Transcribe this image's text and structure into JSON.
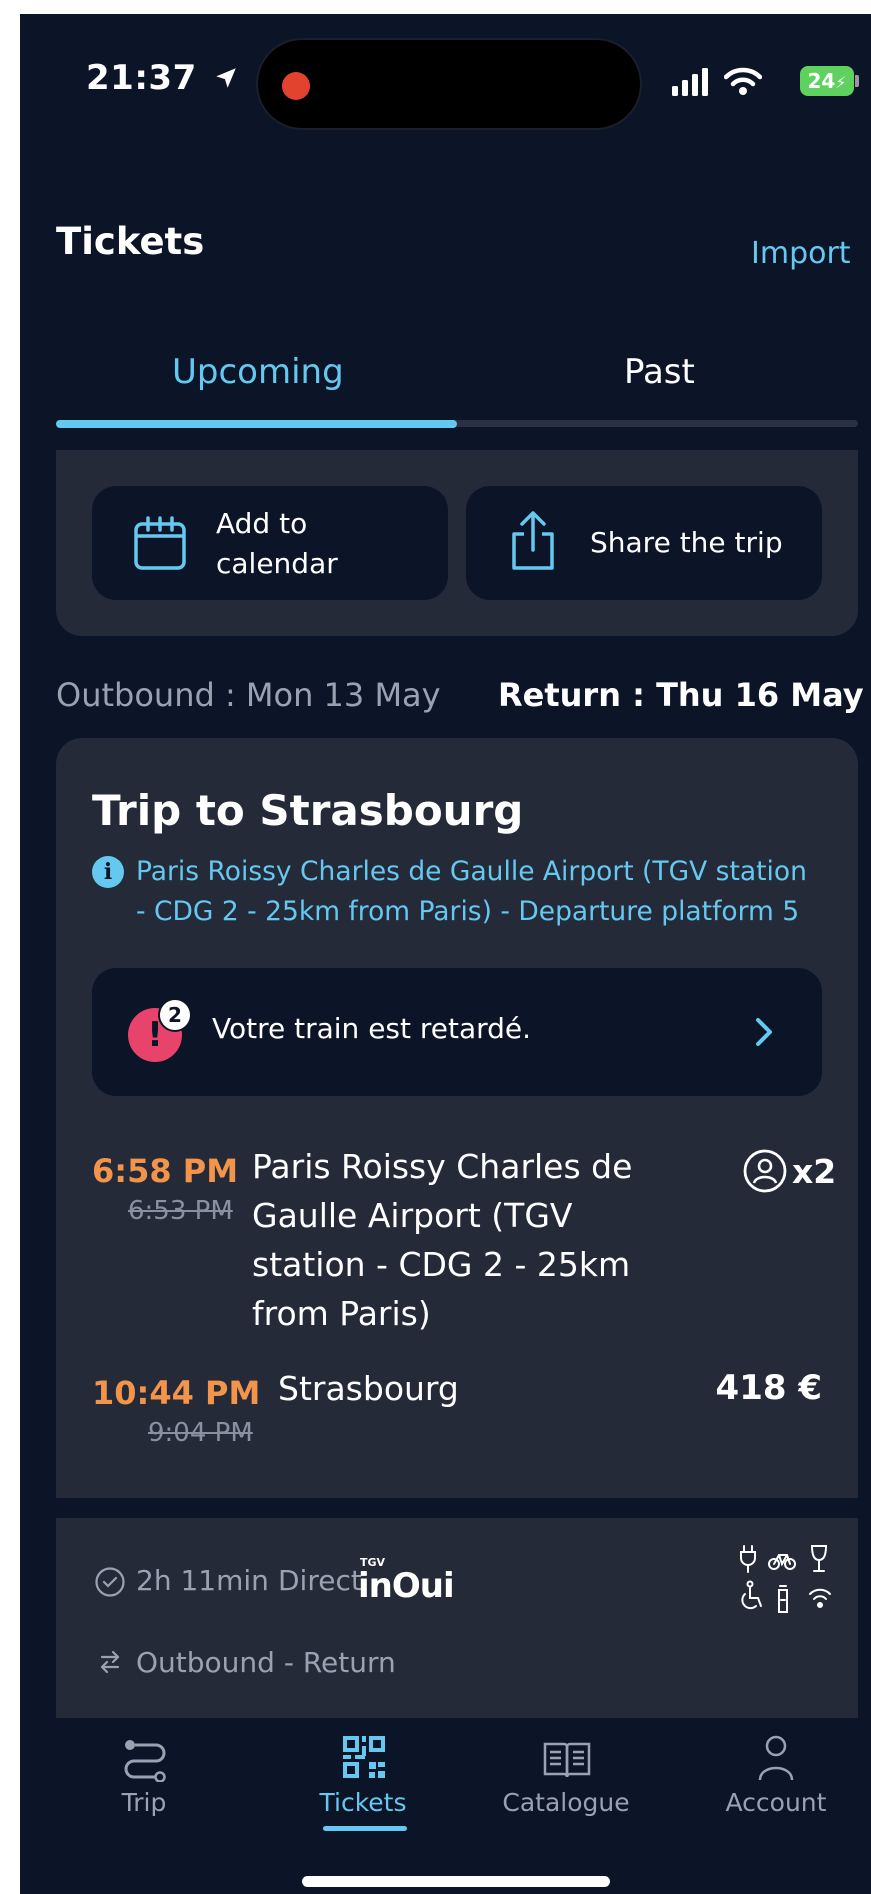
{
  "status_bar": {
    "time": "21:37",
    "battery": "24"
  },
  "header": {
    "title": "Tickets",
    "import_label": "Import"
  },
  "tabs": [
    {
      "label": "Upcoming",
      "active": true
    },
    {
      "label": "Past",
      "active": false
    }
  ],
  "actions": {
    "calendar_line1": "Add to",
    "calendar_line2": "calendar",
    "share_label": "Share the trip"
  },
  "dates": {
    "outbound": "Outbound : Mon 13 May",
    "return": "Return : Thu 16 May"
  },
  "trip": {
    "title": "Trip to Strasbourg",
    "info_line1": "Paris Roissy Charles de Gaulle Airport (TGV station",
    "info_line2": "- CDG 2 - 25km from Paris) - Departure platform 5",
    "alert_text": "Votre train est retardé.",
    "alert_count": "2",
    "departure": {
      "time": "6:58 PM",
      "scheduled_time": "6:53 PM",
      "station_lines": [
        "Paris Roissy Charles de",
        "Gaulle Airport (TGV",
        "station - CDG 2 - 25km",
        "from Paris)"
      ]
    },
    "arrival": {
      "time": "10:44 PM",
      "scheduled_time": "9:04 PM",
      "station": "Strasbourg"
    },
    "passengers": "x2",
    "price": "418 €",
    "duration": "2h 11min",
    "type": "Direct",
    "brand_top": "TGV",
    "brand_name": "inOui",
    "direction": "Outbound - Return"
  },
  "nav": [
    {
      "label": "Trip",
      "icon": "route-icon",
      "active": false
    },
    {
      "label": "Tickets",
      "icon": "qr-code-icon",
      "active": true
    },
    {
      "label": "Catalogue",
      "icon": "book-icon",
      "active": false
    },
    {
      "label": "Account",
      "icon": "person-icon",
      "active": false
    }
  ],
  "colors": {
    "background": "#0c1427",
    "card": "#252a39",
    "accent": "#65c8f0",
    "delay": "#f2944a",
    "alert": "#e8436a"
  }
}
